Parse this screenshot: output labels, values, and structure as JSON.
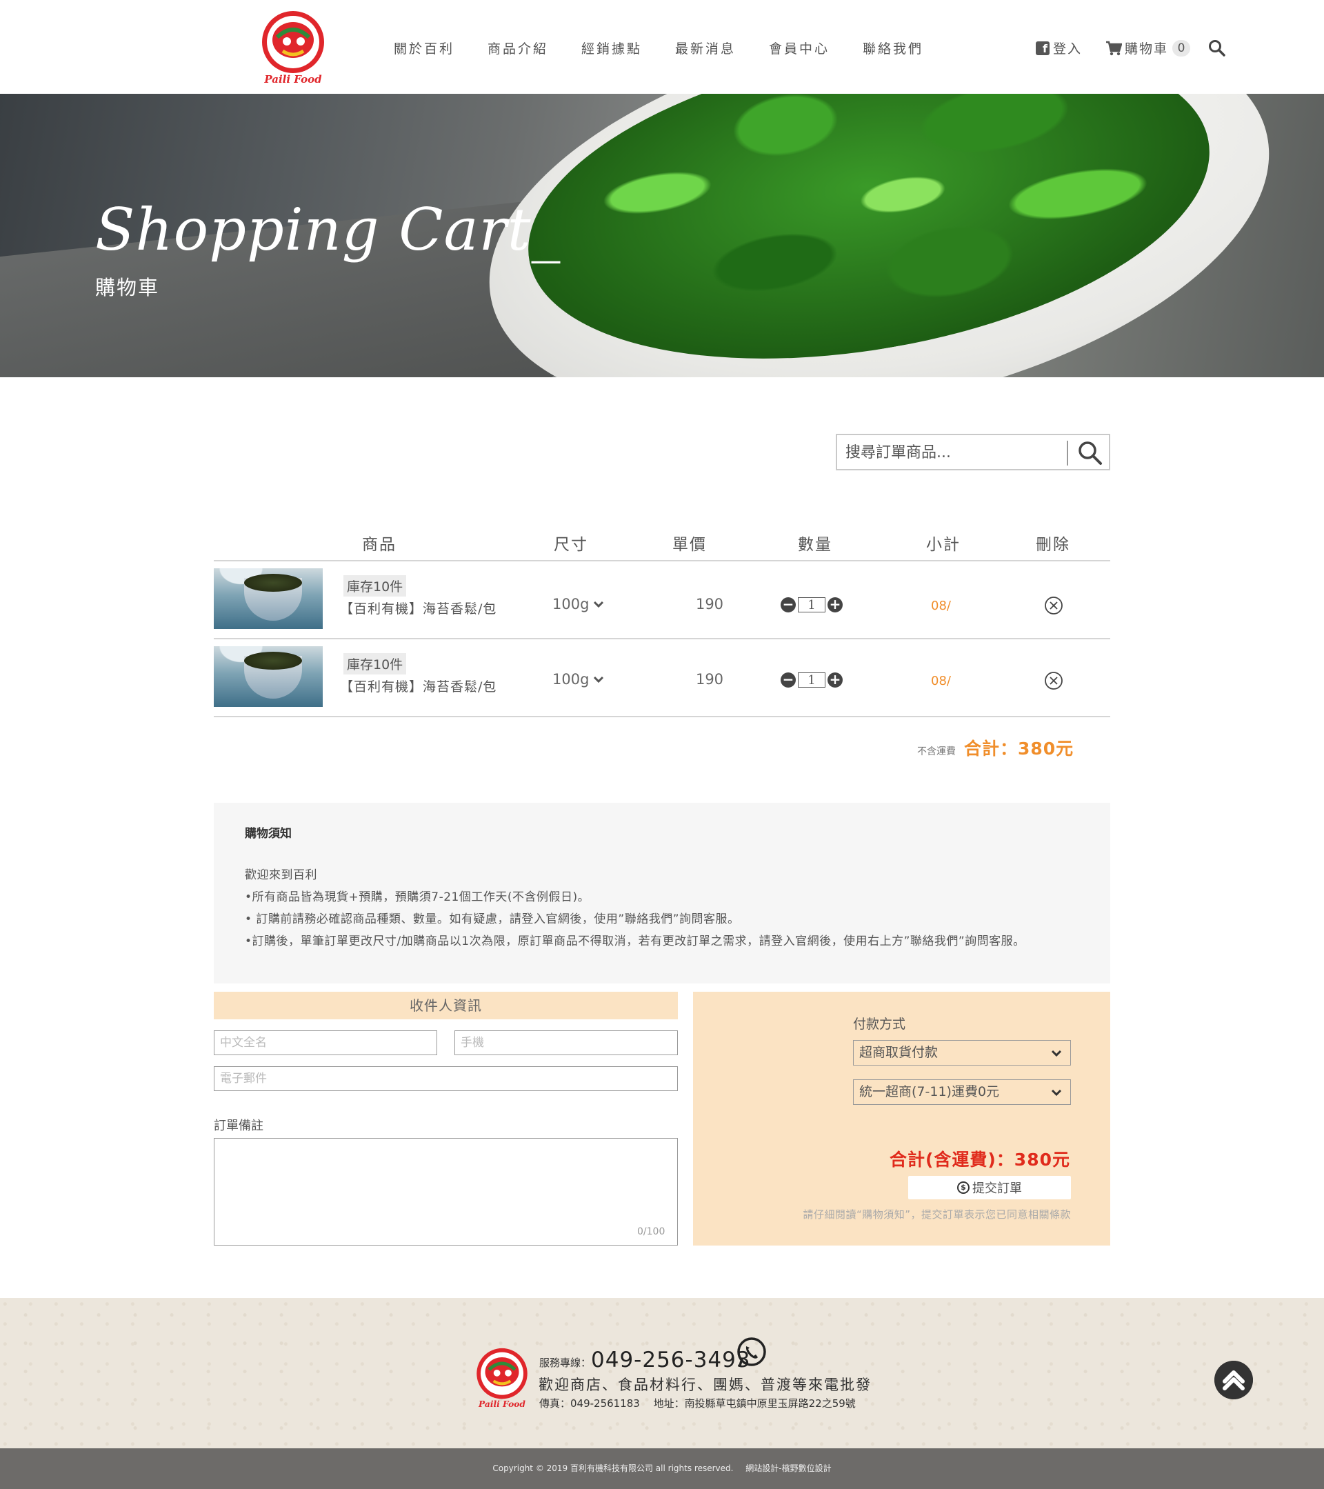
{
  "header": {
    "brand": "Paili Food",
    "brand_mark": "百利",
    "nav": [
      "關於百利",
      "商品介紹",
      "經銷據點",
      "最新消息",
      "會員中心",
      "聯絡我們"
    ],
    "login_label": "登入",
    "cart_label": "購物車",
    "cart_count": "0"
  },
  "hero": {
    "title": "Shopping Cart_",
    "subtitle": "購物車"
  },
  "order_search": {
    "placeholder": "搜尋訂單商品..."
  },
  "cart_table": {
    "headers": {
      "product": "商品",
      "spec": "尺寸",
      "unit_price": "單價",
      "quantity": "數量",
      "subtotal": "小計",
      "delete": "刪除"
    },
    "rows": [
      {
        "stock": "庫存10件",
        "name": "【百利有機】海苔香鬆/包",
        "spec": "100g",
        "price": "190",
        "qty": "1",
        "subtotal": "08/"
      },
      {
        "stock": "庫存10件",
        "name": "【百利有機】海苔香鬆/包",
        "spec": "100g",
        "price": "190",
        "qty": "1",
        "subtotal": "08/"
      }
    ],
    "shipping_note": "不含運費",
    "total": "合計：380元"
  },
  "notice": {
    "title": "購物須知",
    "lines": [
      "歡迎來到百利",
      "•所有商品皆為現貨+預購，預購須7-21個工作天(不含例假日)。",
      "• 訂購前請務必確認商品種類、數量。如有疑慮，請登入官網後，使用”聯絡我們”詢問客服。",
      "•訂購後，單筆訂單更改尺寸/加購商品以1次為限，原訂單商品不得取消，若有更改訂單之需求，請登入官網後，使用右上方”聯絡我們”詢問客服。"
    ]
  },
  "receiver": {
    "title": "收件人資訊",
    "name_placeholder": "中文全名",
    "phone_placeholder": "手機",
    "email_placeholder": "電子郵件",
    "remark_label": "訂單備註",
    "remark_counter": "0/100"
  },
  "payment": {
    "title": "付款方式",
    "method": "超商取貨付款",
    "shipping": "統一超商(7-11)運費0元",
    "grand_total": "合計(含運費)：380元",
    "submit_label": "提交訂單",
    "hint": "請仔細閱讀“購物須知”，提交訂單表示您已同意相關條款"
  },
  "footer": {
    "service_label": "服務專線：",
    "phone": "049-256-3493",
    "welcome": "歡迎商店、食品材料行、團媽、普渡等來電批發",
    "fax_address": "傳真：049-2561183　 地址：南投縣草屯鎮中原里玉屏路22之59號",
    "copyright": "Copyright © 2019 百利有機科技有限公司 all rights reserved.",
    "designer": "網站設計-檳野數位設計"
  },
  "colors": {
    "accent_orange": "#f08e2b",
    "grand_total_red": "#e02b1c",
    "panel_peach": "#fbe3c3"
  }
}
